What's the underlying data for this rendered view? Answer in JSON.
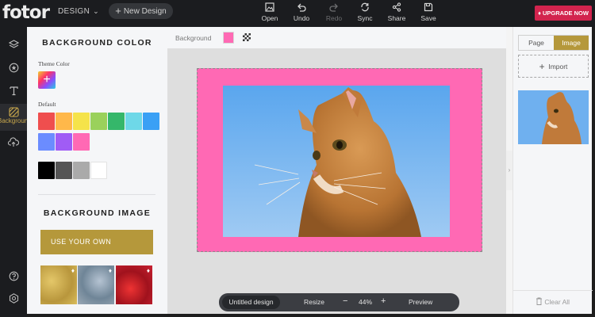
{
  "topbar": {
    "logo": "fotor",
    "design_menu": "DESIGN",
    "new_design": "New Design",
    "tools": [
      {
        "label": "Open",
        "icon": "open-image-icon"
      },
      {
        "label": "Undo",
        "icon": "undo-icon"
      },
      {
        "label": "Redo",
        "icon": "redo-icon",
        "disabled": true
      },
      {
        "label": "Sync",
        "icon": "sync-icon"
      },
      {
        "label": "Share",
        "icon": "share-icon"
      },
      {
        "label": "Save",
        "icon": "save-icon"
      }
    ],
    "upgrade": "UPGRADE NOW"
  },
  "rail": {
    "items": [
      "layers-icon",
      "sticker-icon",
      "text-icon",
      "background-icon",
      "cloud-upload-icon",
      "help-icon",
      "settings-icon"
    ],
    "active_label": "Background"
  },
  "left_panel": {
    "bg_color_title": "BACKGROUND COLOR",
    "theme_color_label": "Theme Color",
    "default_label": "Default",
    "default_colors": [
      "#ef4e4e",
      "#ffb84a",
      "#f5e34a",
      "#9ad15b",
      "#35b76a",
      "#6ed8e8",
      "#3aa0f5",
      "#6b8cff",
      "#a05cf5",
      "#ff69b4"
    ],
    "neutral_colors": [
      "#000000",
      "#555555",
      "#aaaaaa",
      "#ffffff"
    ],
    "bg_image_title": "BACKGROUND IMAGE",
    "use_own": "USE YOUR OWN",
    "thumbnails": [
      "gold-glitter",
      "silver-glitter",
      "red-glitter"
    ]
  },
  "canvas": {
    "bg_label": "Background",
    "bg_color": "#ff69b4"
  },
  "bottom_bar": {
    "title": "Untitled design",
    "resize": "Resize",
    "zoom_out": "−",
    "zoom": "44%",
    "zoom_in": "+",
    "preview": "Preview"
  },
  "right_panel": {
    "tab_page": "Page",
    "tab_image": "Image",
    "import": "Import",
    "clear_all": "Clear All"
  }
}
